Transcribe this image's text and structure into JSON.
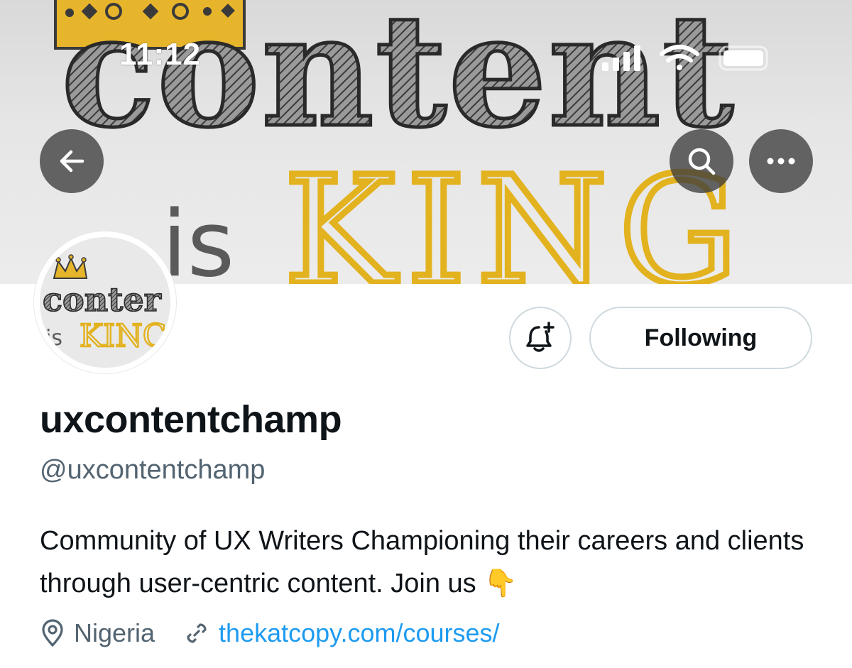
{
  "status_bar": {
    "time": "11:12"
  },
  "banner": {
    "word_top": "content",
    "word_is": "is",
    "word_king": "KING"
  },
  "avatar": {
    "word_top": "conter",
    "word_is": "is",
    "word_king": "KINC"
  },
  "profile": {
    "display_name": "uxcontentchamp",
    "handle": "@uxcontentchamp",
    "bio": "Community of UX Writers Championing their careers and clients through user-centric content. Join us 👇",
    "location": "Nigeria",
    "website": "thekatcopy.com/courses/"
  },
  "actions": {
    "following_label": "Following"
  },
  "icons": {
    "back": "arrow-left-icon",
    "search": "search-icon",
    "more": "more-icon",
    "notify": "bell-plus-icon",
    "location": "location-pin-icon",
    "link": "link-icon"
  },
  "colors": {
    "accent_link": "#1d9bf0",
    "secondary_text": "#536471",
    "primary_text": "#0f1419",
    "crown_gold": "#e7b52b",
    "king_yellow": "#e2b21f"
  }
}
